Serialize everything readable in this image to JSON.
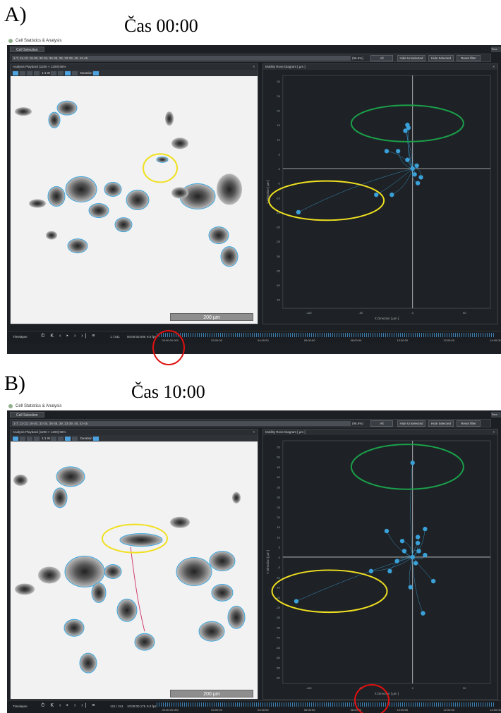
{
  "figure": {
    "a": {
      "letter": "A)",
      "title": "Čas 00:00"
    },
    "b": {
      "letter": "B)",
      "title": "Čas 10:00"
    }
  },
  "app": {
    "title": "Cell Statistics & Analysis",
    "tab": "Cell Selection",
    "tab_right": "Time",
    "selection_a": "1-7, 11-13, 16-30, 32-34, 36-38, 39, 33-39, 40, 42-45",
    "selection_b": "1-7, 11-13, 16-30, 32-34, 36-38, 39, 33-39, 40, 42-45",
    "selection_pct": "(96.6%)",
    "buttons": {
      "all": "All",
      "hide_unselected": "Hide Unselected",
      "hide_selected": "Hide Selected",
      "reset": "Reset filter"
    },
    "left_panel_title": "Analysis Playback [1200 × 1200] 65%",
    "left_panel_title_b": "Analysis Playback [1200 × 1200] 65%",
    "tools_text": "1:1 W",
    "duration_label": "Duration",
    "right_panel_title": "Motility Rose Diagram [ µm ]",
    "close": "×",
    "scale_bar": "200 µm",
    "x_axis_label": "X Direction [ µm ]",
    "y_axis_label": "Y Direction [ µm ]",
    "timeline_label": "Timelapse",
    "timeline_controls": "⏱ K ‹ ▸ › ›| ≡",
    "frame_a": "1 / 241",
    "time_a": "00:00:00.000",
    "frame_b": "121 / 241",
    "time_b": "10:00:00.175",
    "fps": "9.0 fps",
    "ticks": [
      "00:00:00.000",
      "02:00:00",
      "04:00:00",
      "06:00:00",
      "08:00:00",
      "10:00:00",
      "12:00:00",
      "14:00:00"
    ]
  },
  "chart_data": [
    {
      "type": "scatter",
      "panel": "A",
      "title": "Motility Rose Diagram [ µm ]",
      "xlabel": "X Direction [ µm ]",
      "ylabel": "Y Direction [ µm ]",
      "x_ticks": [
        -100,
        -50,
        0,
        50
      ],
      "y_ticks": [
        30,
        25,
        20,
        15,
        10,
        5,
        0,
        -5,
        -10,
        -15,
        -20,
        -25,
        -30,
        -35,
        -40,
        -45
      ],
      "xlim": [
        -125,
        75
      ],
      "ylim": [
        -48,
        32
      ],
      "points": [
        {
          "x": -5,
          "y": 15
        },
        {
          "x": -7,
          "y": 13
        },
        {
          "x": -4,
          "y": 14
        },
        {
          "x": -25,
          "y": 6
        },
        {
          "x": -14,
          "y": 6
        },
        {
          "x": -5,
          "y": 3
        },
        {
          "x": 4,
          "y": 1
        },
        {
          "x": 2,
          "y": -2
        },
        {
          "x": 5,
          "y": -5
        },
        {
          "x": 8,
          "y": -3
        },
        {
          "x": -35,
          "y": -9
        },
        {
          "x": -20,
          "y": -9
        },
        {
          "x": -110,
          "y": -15
        },
        {
          "x": 0,
          "y": 0
        }
      ]
    },
    {
      "type": "scatter",
      "panel": "B",
      "title": "Motility Rose Diagram [ µm ]",
      "xlabel": "X Direction [ µm ]",
      "ylabel": "Y Direction [ µm ]",
      "x_ticks": [
        -100,
        -50,
        0,
        50
      ],
      "y_ticks": [
        55,
        50,
        45,
        40,
        35,
        30,
        25,
        20,
        15,
        10,
        5,
        0,
        -5,
        -10,
        -15,
        -20,
        -25,
        -30,
        -35,
        -40,
        -45,
        -50,
        -55,
        -60
      ],
      "xlim": [
        -125,
        75
      ],
      "ylim": [
        -63,
        58
      ],
      "points": [
        {
          "x": 0,
          "y": 47
        },
        {
          "x": 12,
          "y": 14
        },
        {
          "x": -25,
          "y": 13
        },
        {
          "x": -10,
          "y": 8
        },
        {
          "x": 5,
          "y": 7
        },
        {
          "x": -8,
          "y": 3
        },
        {
          "x": 6,
          "y": 3
        },
        {
          "x": 12,
          "y": 1
        },
        {
          "x": 0,
          "y": 0
        },
        {
          "x": -15,
          "y": -2
        },
        {
          "x": 3,
          "y": -3
        },
        {
          "x": -40,
          "y": -7
        },
        {
          "x": -22,
          "y": -7
        },
        {
          "x": 20,
          "y": -12
        },
        {
          "x": -2,
          "y": -15
        },
        {
          "x": -112,
          "y": -22
        },
        {
          "x": 10,
          "y": -28
        },
        {
          "x": 5,
          "y": 10
        }
      ]
    }
  ],
  "colors": {
    "green_ring": "#1aa04a",
    "yellow_ring": "#f0e020",
    "red_ring": "#e01010",
    "track": "#3aa0d8",
    "cell_outline": "#3ea8e0"
  }
}
